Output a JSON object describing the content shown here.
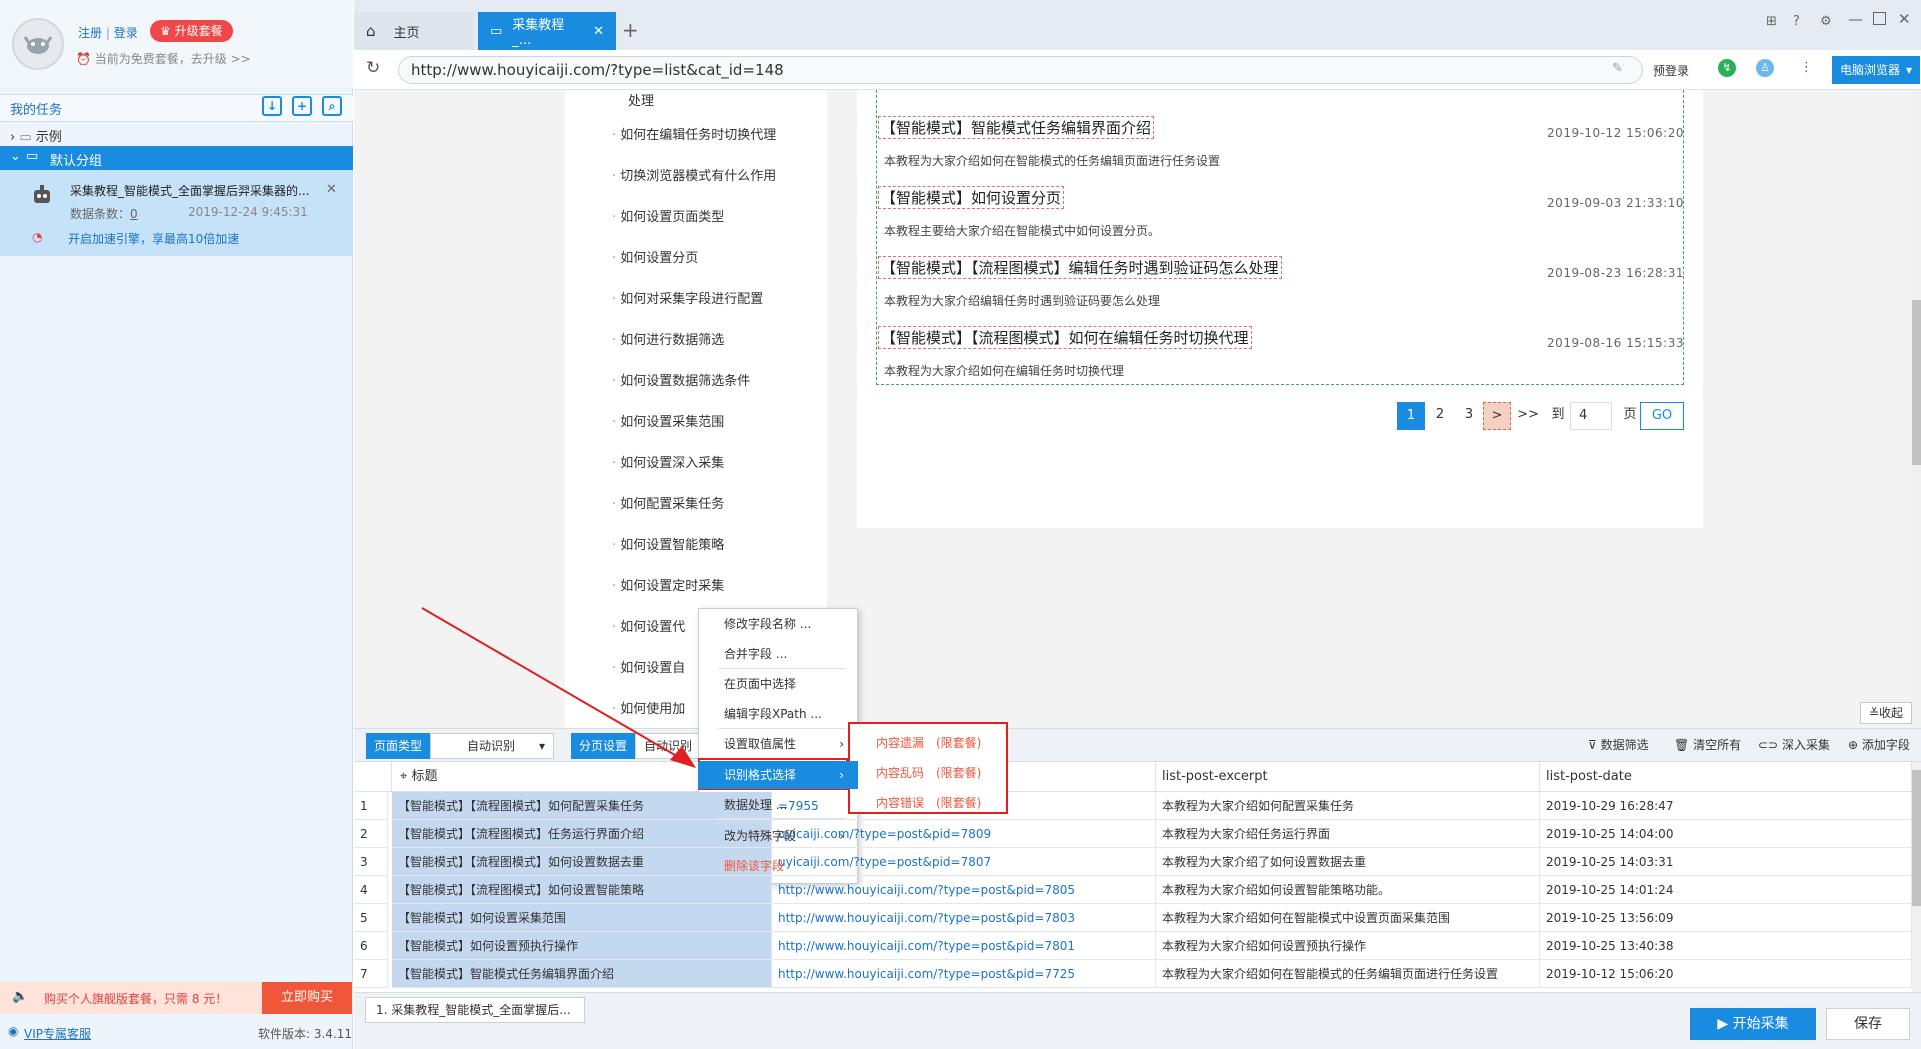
{
  "account": {
    "register": "注册",
    "sep": "|",
    "login": "登录",
    "upgrade": "升级套餐",
    "plan": "当前为免费套餐，去升级 >>"
  },
  "sidebar": {
    "title": "我的任务",
    "example_folder": "示例",
    "default_group": "默认分组",
    "task": {
      "name": "采集教程_智能模式_全面掌握后羿采集器的...",
      "count_label": "数据条数：",
      "count": "0",
      "time": "2019-12-24 9:45:31",
      "accel": "开启加速引擎，享最高10倍加速"
    },
    "promo": "购买个人旗舰版套餐，只需 8 元！",
    "buy": "立即购买",
    "vip": "VIP专属客服",
    "version": "软件版本: 3.4.11"
  },
  "tabs": [
    {
      "label": "主页"
    },
    {
      "label": "采集教程_..."
    }
  ],
  "address": {
    "url": "http://www.houyicaiji.com/?type=list&cat_id=148",
    "prelogin": "预登录",
    "browser": "电脑浏览器"
  },
  "categories": [
    "处理",
    "如何在编辑任务时切换代理",
    "切换浏览器模式有什么作用",
    "如何设置页面类型",
    "如何设置分页",
    "如何对采集字段进行配置",
    "如何进行数据筛选",
    "如何设置数据筛选条件",
    "如何设置采集范围",
    "如何设置深入采集",
    "如何配置采集任务",
    "如何设置智能策略",
    "如何设置定时采集",
    "如何设置代",
    "如何设置自",
    "如何使用加"
  ],
  "posts": [
    {
      "title": "【智能模式】智能模式任务编辑界面介绍",
      "date": "2019-10-12 15:06:20",
      "excerpt": "本教程为大家介绍如何在智能模式的任务编辑页面进行任务设置"
    },
    {
      "title": "【智能模式】如何设置分页",
      "date": "2019-09-03 21:33:10",
      "excerpt": "本教程主要给大家介绍在智能模式中如何设置分页。"
    },
    {
      "title": "【智能模式】【流程图模式】编辑任务时遇到验证码怎么处理",
      "date": "2019-08-23 16:28:31",
      "excerpt": "本教程为大家介绍编辑任务时遇到验证码要怎么处理"
    },
    {
      "title": "【智能模式】【流程图模式】如何在编辑任务时切换代理",
      "date": "2019-08-16 15:15:33",
      "excerpt": "本教程为大家介绍如何在编辑任务时切换代理"
    }
  ],
  "pagination": {
    "pages": [
      "1",
      "2",
      "3"
    ],
    "next": ">",
    "last": ">>",
    "to": "到",
    "input": "4",
    "page": "页",
    "go": "GO"
  },
  "toolbar": {
    "page_type_label": "页面类型",
    "page_type_value": "自动识别",
    "paging_label": "分页设置",
    "paging_value": "自动识别分",
    "filter": "数据筛选",
    "clear": "清空所有",
    "deep": "深入采集",
    "add_field": "添加字段",
    "collapse": "收起"
  },
  "table": {
    "headers": [
      "标题",
      "list-post-excerpt",
      "list-post-date"
    ],
    "rows": [
      {
        "n": "1",
        "title": "【智能模式】【流程图模式】如何配置采集任务",
        "link": "=7955",
        "excerpt": "本教程为大家介绍如何配置采集任务",
        "date": "2019-10-29 16:28:47"
      },
      {
        "n": "2",
        "title": "【智能模式】【流程图模式】任务运行界面介绍",
        "link": "uyicaiji.com/?type=post&pid=7809",
        "excerpt": "本教程为大家介绍任务运行界面",
        "date": "2019-10-25 14:04:00"
      },
      {
        "n": "3",
        "title": "【智能模式】【流程图模式】如何设置数据去重",
        "link": "uyicaiji.com/?type=post&pid=7807",
        "excerpt": "本教程为大家介绍了如何设置数据去重",
        "date": "2019-10-25 14:03:31"
      },
      {
        "n": "4",
        "title": "【智能模式】【流程图模式】如何设置智能策略",
        "link": "http://www.houyicaiji.com/?type=post&pid=7805",
        "excerpt": "本教程为大家介绍如何设置智能策略功能。",
        "date": "2019-10-25 14:01:24"
      },
      {
        "n": "5",
        "title": "【智能模式】如何设置采集范围",
        "link": "http://www.houyicaiji.com/?type=post&pid=7803",
        "excerpt": "本教程为大家介绍如何在智能模式中设置页面采集范围",
        "date": "2019-10-25 13:56:09"
      },
      {
        "n": "6",
        "title": "【智能模式】如何设置预执行操作",
        "link": "http://www.houyicaiji.com/?type=post&pid=7801",
        "excerpt": "本教程为大家介绍如何设置预执行操作",
        "date": "2019-10-25 13:40:38"
      },
      {
        "n": "7",
        "title": "【智能模式】智能模式任务编辑界面介绍",
        "link": "http://www.houyicaiji.com/?type=post&pid=7725",
        "excerpt": "本教程为大家介绍如何在智能模式的任务编辑页面进行任务设置",
        "date": "2019-10-12 15:06:20"
      }
    ]
  },
  "context_menu": [
    "修改字段名称 ...",
    "合并字段 ...",
    "在页面中选择",
    "编辑字段XPath ...",
    "设置取值属性",
    "识别格式选择",
    "数据处理 ...",
    "改为特殊字段",
    "删除该字段"
  ],
  "submenu": [
    "内容遗漏　(限套餐)",
    "内容乱码　(限套餐)",
    "内容错误　(限套餐)"
  ],
  "bottom": {
    "task_tab": "1. 采集教程_智能模式_全面掌握后...",
    "start": "开始采集",
    "save": "保存"
  },
  "colors": {
    "accent": "#1a8ce0",
    "highlight_red": "#e02020",
    "promo_red": "#f0563a"
  }
}
